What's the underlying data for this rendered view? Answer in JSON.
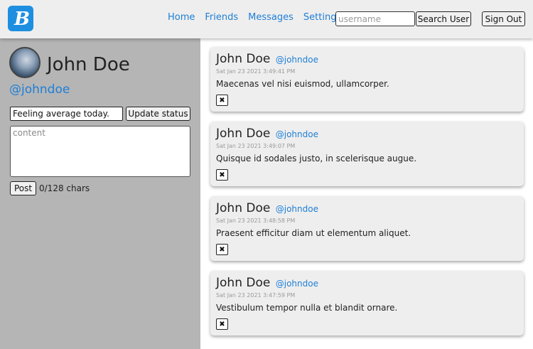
{
  "nav": {
    "links": [
      "Home",
      "Friends",
      "Messages",
      "Settings"
    ],
    "search_placeholder": "username",
    "search_button": "Search User",
    "signout_button": "Sign Out",
    "brand_color": "#1e8fe0",
    "link_color": "#1e7fd6"
  },
  "profile": {
    "name": "John Doe",
    "handle": "@johndoe",
    "status_value": "Feeling average today.",
    "update_button": "Update status",
    "content_placeholder": "content",
    "post_button": "Post",
    "char_count": "0/128 chars"
  },
  "posts": [
    {
      "author": "John Doe",
      "handle": "@johndoe",
      "time": "Sat Jan 23 2021 3:49:41 PM",
      "text": "Maecenas vel nisi euismod, ullamcorper.",
      "delete_icon": "✖"
    },
    {
      "author": "John Doe",
      "handle": "@johndoe",
      "time": "Sat Jan 23 2021 3:49:07 PM",
      "text": "Quisque id sodales justo, in scelerisque augue.",
      "delete_icon": "✖"
    },
    {
      "author": "John Doe",
      "handle": "@johndoe",
      "time": "Sat Jan 23 2021 3:48:58 PM",
      "text": "Praesent efficitur diam ut elementum aliquet.",
      "delete_icon": "✖"
    },
    {
      "author": "John Doe",
      "handle": "@johndoe",
      "time": "Sat Jan 23 2021 3:47:59 PM",
      "text": "Vestibulum tempor nulla et blandit ornare.",
      "delete_icon": "✖"
    }
  ]
}
